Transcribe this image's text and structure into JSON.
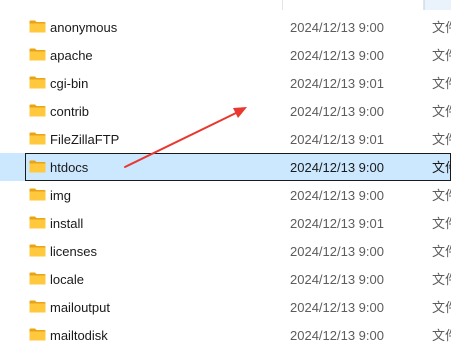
{
  "folders": [
    {
      "name": "anonymous",
      "modified": "2024/12/13 9:00",
      "type": "文件夹",
      "selected": false
    },
    {
      "name": "apache",
      "modified": "2024/12/13 9:00",
      "type": "文件夹",
      "selected": false
    },
    {
      "name": "cgi-bin",
      "modified": "2024/12/13 9:01",
      "type": "文件夹",
      "selected": false
    },
    {
      "name": "contrib",
      "modified": "2024/12/13 9:00",
      "type": "文件夹",
      "selected": false
    },
    {
      "name": "FileZillaFTP",
      "modified": "2024/12/13 9:01",
      "type": "文件夹",
      "selected": false
    },
    {
      "name": "htdocs",
      "modified": "2024/12/13 9:00",
      "type": "文件夹",
      "selected": true
    },
    {
      "name": "img",
      "modified": "2024/12/13 9:00",
      "type": "文件夹",
      "selected": false
    },
    {
      "name": "install",
      "modified": "2024/12/13 9:01",
      "type": "文件夹",
      "selected": false
    },
    {
      "name": "licenses",
      "modified": "2024/12/13 9:00",
      "type": "文件夹",
      "selected": false
    },
    {
      "name": "locale",
      "modified": "2024/12/13 9:00",
      "type": "文件夹",
      "selected": false
    },
    {
      "name": "mailoutput",
      "modified": "2024/12/13 9:00",
      "type": "文件夹",
      "selected": false
    },
    {
      "name": "mailtodisk",
      "modified": "2024/12/13 9:00",
      "type": "文件夹",
      "selected": false
    }
  ],
  "icons": {
    "folder": "folder-icon"
  },
  "colors": {
    "selection_bg": "#cce8ff",
    "folder_yellow": "#ffc83d",
    "folder_dark": "#e8a317",
    "annotation_arrow": "#e8382f",
    "meta_text": "#5c5c5c"
  }
}
